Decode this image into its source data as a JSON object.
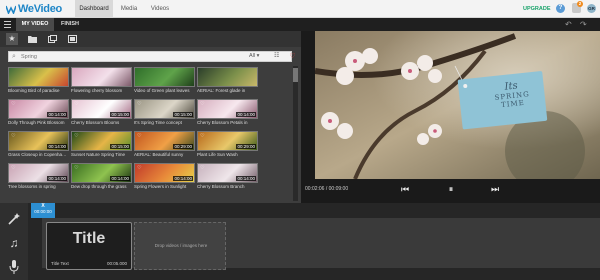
{
  "app": {
    "logo_text": "WeVideo",
    "nav_tabs": [
      "Dashboard",
      "Media",
      "Videos"
    ],
    "upgrade_label": "UPGRADE",
    "help_icon": "?",
    "notification_count": "2",
    "user_initials": "GR"
  },
  "subbar": {
    "tabs": [
      "MY VIDEO",
      "FINISH"
    ]
  },
  "library": {
    "search_placeholder": "Spring",
    "filter_value": "All",
    "clips": [
      {
        "title": "Blooming Bird of paradise",
        "duration": ""
      },
      {
        "title": "Flowering cherry blossom",
        "duration": ""
      },
      {
        "title": "Video of Green plant leaves",
        "duration": ""
      },
      {
        "title": "AERIAL: Forest glade in",
        "duration": ""
      },
      {
        "title": "Dolly Through Pink Blossom",
        "duration": "00:14:00"
      },
      {
        "title": "Cherry Blossom Blooms",
        "duration": "00:15:00"
      },
      {
        "title": "It's Spring Time concept",
        "duration": "00:15:00"
      },
      {
        "title": "Cherry Blossom Petals in",
        "duration": "00:14:00"
      },
      {
        "title": "Grass Closeup in Copenhagen",
        "duration": "00:14:00"
      },
      {
        "title": "Sunset Nature Spring Time",
        "duration": "00:15:00"
      },
      {
        "title": "AERIAL: Beautiful sunny",
        "duration": "00:29:00"
      },
      {
        "title": "Plant Life Sun Wash",
        "duration": "00:29:00"
      },
      {
        "title": "Tree blossoms in spring",
        "duration": "00:14:00"
      },
      {
        "title": "Dew drop through the grass",
        "duration": "00:14:00"
      },
      {
        "title": "Spring Flowers in Sunlight",
        "duration": "00:14:00"
      },
      {
        "title": "Cherry Blossom Branch",
        "duration": "00:14:00"
      }
    ]
  },
  "player": {
    "timecode": "00:02:06 / 00:09:00",
    "still_text_line1": "Its",
    "still_text_line2": "SPRING",
    "still_text_line3": "TIME"
  },
  "timeline": {
    "playhead_time": "00:00:00",
    "playhead_close": "X",
    "title_clip_big": "Title",
    "title_clip_label": "Title Text",
    "title_clip_duration": "00:05.000",
    "drop_hint": "Drop videos / images here"
  }
}
